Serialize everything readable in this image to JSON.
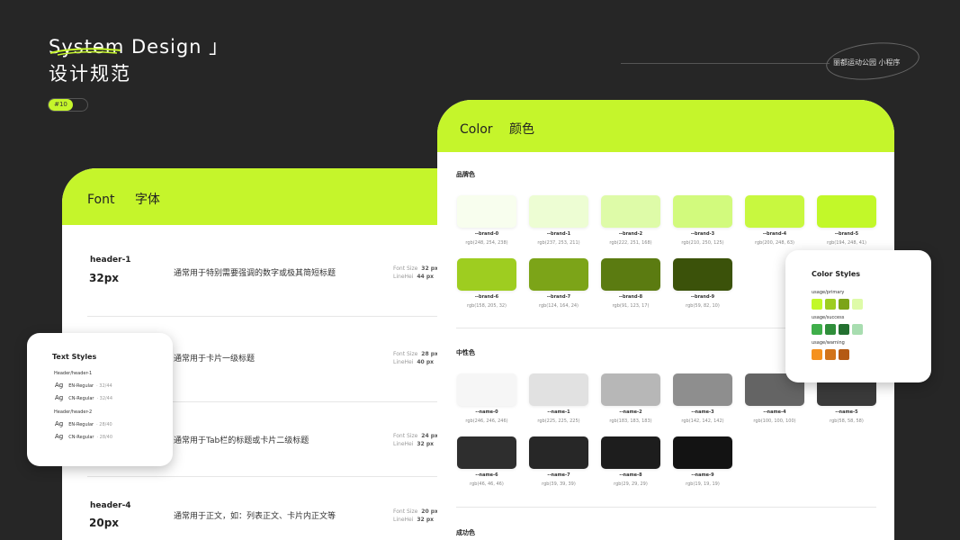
{
  "hero": {
    "title": "System Design 」",
    "subtitle": "设计规范",
    "badge": "#10"
  },
  "tag": {
    "text": "丽都运动公园 小程序"
  },
  "font_card": {
    "title_en": "Font",
    "title_cn": "字体",
    "rows": [
      {
        "name": "header-1",
        "size": "32px",
        "desc": "通常用于特别需要强调的数字或极其简短标题",
        "font_size_label": "Font Size",
        "font_size": "32 px",
        "line_height_label": "LineHei",
        "line_height": "44 px"
      },
      {
        "name": "",
        "size": "",
        "desc": "通常用于卡片一级标题",
        "font_size_label": "Font Size",
        "font_size": "28 px",
        "line_height_label": "LineHei",
        "line_height": "40 px"
      },
      {
        "name": "",
        "size": "",
        "desc": "通常用于Tab栏的标题或卡片二级标题",
        "font_size_label": "Font Size",
        "font_size": "24 px",
        "line_height_label": "LineHei",
        "line_height": "32 px"
      },
      {
        "name": "header-4",
        "size": "20px",
        "desc": "通常用于正文，如：列表正文、卡片内正文等",
        "font_size_label": "Font Size",
        "font_size": "20 px",
        "line_height_label": "LineHei",
        "line_height": "32 px"
      }
    ]
  },
  "color_card": {
    "title_en": "Color",
    "title_cn": "颜色",
    "sections": [
      {
        "label": "品牌色",
        "swatches": [
          {
            "name": "--brand-0",
            "rgb": "rgb(248, 254, 238)",
            "color": "#f8feee"
          },
          {
            "name": "--brand-1",
            "rgb": "rgb(237, 253, 211)",
            "color": "#edfdd3"
          },
          {
            "name": "--brand-2",
            "rgb": "rgb(222, 251, 168)",
            "color": "#defba8"
          },
          {
            "name": "--brand-3",
            "rgb": "rgb(210, 250, 125)",
            "color": "#d2fa7d"
          },
          {
            "name": "--brand-4",
            "rgb": "rgb(200, 248, 63)",
            "color": "#c8f83f"
          },
          {
            "name": "--brand-5",
            "rgb": "rgb(194, 248, 41)",
            "color": "#c2f829"
          },
          {
            "name": "--brand-6",
            "rgb": "rgb(158, 205, 32)",
            "color": "#9ecd20"
          },
          {
            "name": "--brand-7",
            "rgb": "rgb(124, 164, 24)",
            "color": "#7ca418"
          },
          {
            "name": "--brand-8",
            "rgb": "rgb(91, 123, 17)",
            "color": "#5b7b11"
          },
          {
            "name": "--brand-9",
            "rgb": "rgb(59, 82, 10)",
            "color": "#3b520a"
          }
        ]
      },
      {
        "label": "中性色",
        "swatches": [
          {
            "name": "--name-0",
            "rgb": "rgb(246, 246, 246)",
            "color": "#f6f6f6"
          },
          {
            "name": "--name-1",
            "rgb": "rgb(225, 225, 225)",
            "color": "#e1e1e1"
          },
          {
            "name": "--name-2",
            "rgb": "rgb(183, 183, 183)",
            "color": "#b7b7b7"
          },
          {
            "name": "--name-3",
            "rgb": "rgb(142, 142, 142)",
            "color": "#8e8e8e"
          },
          {
            "name": "--name-4",
            "rgb": "rgb(100, 100, 100)",
            "color": "#646464"
          },
          {
            "name": "--name-5",
            "rgb": "rgb(58, 58, 58)",
            "color": "#3a3a3a"
          },
          {
            "name": "--name-6",
            "rgb": "rgb(46, 46, 46)",
            "color": "#2e2e2e"
          },
          {
            "name": "--name-7",
            "rgb": "rgb(39, 39, 39)",
            "color": "#272727"
          },
          {
            "name": "--name-8",
            "rgb": "rgb(29, 29, 29)",
            "color": "#1d1d1d"
          },
          {
            "name": "--name-9",
            "rgb": "rgb(19, 19, 19)",
            "color": "#131313"
          }
        ]
      },
      {
        "label": "成功色",
        "swatches": []
      }
    ]
  },
  "text_styles": {
    "title": "Text Styles",
    "groups": [
      {
        "label": "Header/header-1",
        "items": [
          {
            "ag": "Ag",
            "name": "EN-Regular",
            "val": "· 32/44"
          },
          {
            "ag": "Ag",
            "name": "CN-Regular",
            "val": "· 32/44"
          }
        ]
      },
      {
        "label": "Header/header-2",
        "items": [
          {
            "ag": "Ag",
            "name": "EN-Regular",
            "val": "· 28/40"
          },
          {
            "ag": "Ag",
            "name": "CN-Regular",
            "val": "· 28/40"
          }
        ]
      }
    ]
  },
  "color_styles": {
    "title": "Color Styles",
    "groups": [
      {
        "label": "usage/primary",
        "colors": [
          "#c2f829",
          "#9ecd20",
          "#7ca418",
          "#defba8"
        ]
      },
      {
        "label": "usage/success",
        "colors": [
          "#3fae4a",
          "#2f8e3a",
          "#237030",
          "#a8ddb0"
        ]
      },
      {
        "label": "usage/warning",
        "colors": [
          "#f5911e",
          "#d2741a",
          "#b45a14"
        ]
      }
    ]
  }
}
